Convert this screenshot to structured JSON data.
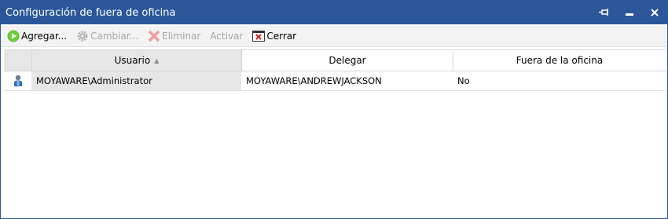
{
  "window": {
    "title": "Configuración de fuera de oficina",
    "accent_color": "#2b579a",
    "pin_icon": "pin-icon",
    "minimize_icon": "minimize-icon",
    "close_icon": "close-icon"
  },
  "toolbar": {
    "add_label": "Agregar...",
    "change_label": "Cambiar...",
    "delete_label": "Eliminar",
    "activate_label": "Activar",
    "close_label": "Cerrar"
  },
  "table": {
    "columns": [
      "Usuario",
      "Delegar",
      "Fuera de la oficina"
    ],
    "sort_column": "Usuario",
    "sort_direction": "ascending",
    "rows": [
      {
        "icon": "user-icon",
        "usuario": "MOYAWARE\\Administrator",
        "delegar": "MOYAWARE\\ANDREWJACKSON",
        "fuera": "No"
      }
    ]
  }
}
